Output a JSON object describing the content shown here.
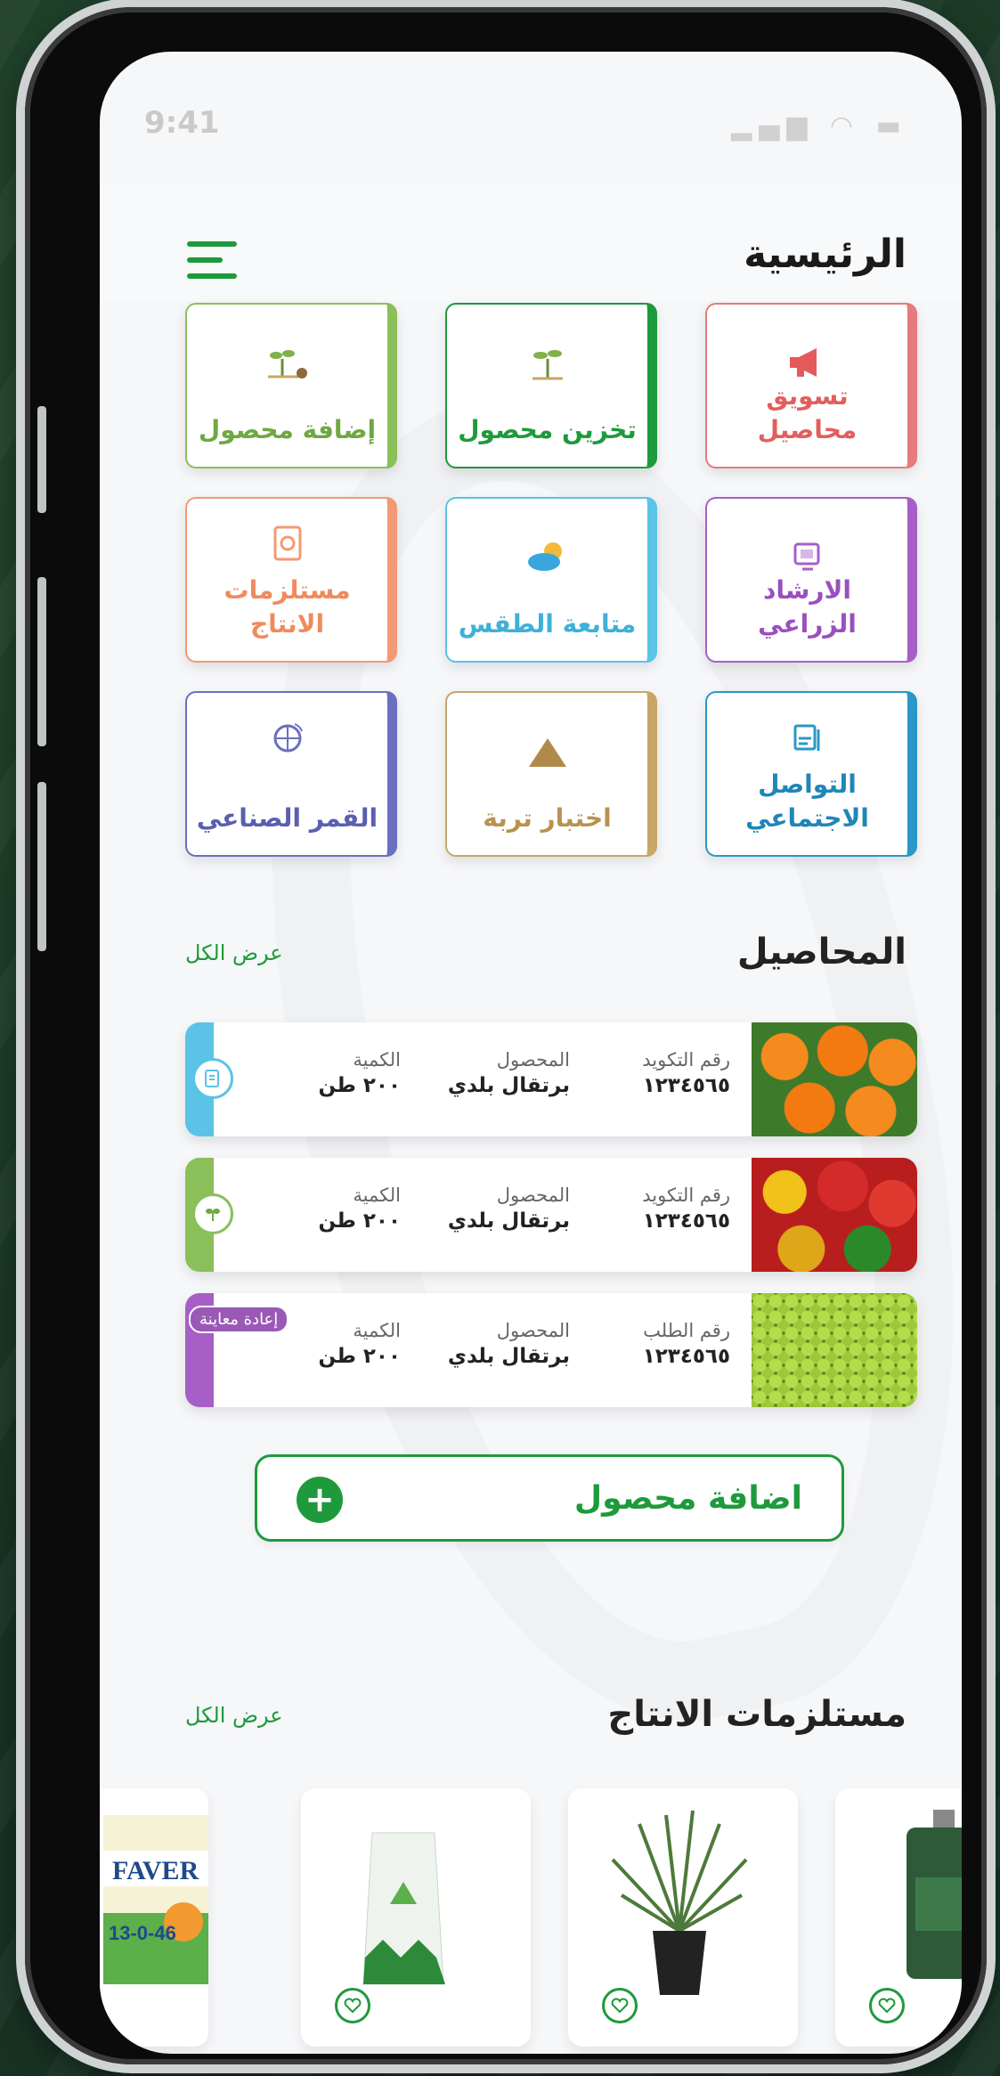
{
  "status_bar": {
    "time": "9:41",
    "icons": [
      "signal-icon",
      "wifi-icon",
      "battery-icon"
    ]
  },
  "header": {
    "title": "الرئيسية",
    "menu_icon": "menu-icon"
  },
  "services": [
    {
      "label": "تسويق محاصيل",
      "icon": "megaphone-icon",
      "color": "#e77a7a"
    },
    {
      "label": "تخزين محصول",
      "icon": "sprout-icon",
      "color": "#1e9a3c"
    },
    {
      "label": "إضافة محصول",
      "icon": "plant-add-icon",
      "color": "#8bbf5a"
    },
    {
      "label": "الارشاد الزراعي",
      "icon": "guide-icon",
      "color": "#a75fc7"
    },
    {
      "label": "متابعة الطقس",
      "icon": "weather-icon",
      "color": "#5bc3e6"
    },
    {
      "label": "مستلزمات الانتاج",
      "icon": "supplies-icon",
      "color": "#f29a73"
    },
    {
      "label": "التواصل الاجتماعي",
      "icon": "social-icon",
      "color": "#2b97c8"
    },
    {
      "label": "اختبار تربة",
      "icon": "soil-icon",
      "color": "#c8a765"
    },
    {
      "label": "القمر الصناعي",
      "icon": "satellite-icon",
      "color": "#6a6fc0"
    }
  ],
  "crops_section": {
    "title": "المحاصيل",
    "view_all": "عرض الكل",
    "items": [
      {
        "code_label": "رقم التكويد",
        "code": "١٢٣٤٥٦٥",
        "product_label": "المحصول",
        "product": "برتقال بلدي",
        "qty_label": "الكمية",
        "qty": "٢٠٠ طن",
        "accent": "#5bc3e6",
        "icon": "crop-doc-icon",
        "photo": "oranges",
        "badge": ""
      },
      {
        "code_label": "رقم التكويد",
        "code": "١٢٣٤٥٦٥",
        "product_label": "المحصول",
        "product": "برتقال بلدي",
        "qty_label": "الكمية",
        "qty": "٢٠٠ طن",
        "accent": "#8bbf5a",
        "icon": "leaf-icon",
        "photo": "peppers",
        "badge": ""
      },
      {
        "code_label": "رقم الطلب",
        "code": "١٢٣٤٥٦٥",
        "product_label": "المحصول",
        "product": "برتقال بلدي",
        "qty_label": "الكمية",
        "qty": "٢٠٠ طن",
        "accent": "#a75fc7",
        "icon": "",
        "photo": "grapes",
        "badge": "إعادة معاينة"
      }
    ]
  },
  "add_crop_button": {
    "label": "اضافة محصول",
    "icon": "plus-icon"
  },
  "supplies_section": {
    "title": "مستلزمات الانتاج",
    "view_all": "عرض الكل",
    "products": [
      {
        "name": "fertilizer-bottle",
        "heart": "heart-icon"
      },
      {
        "name": "plant-pot",
        "heart": "heart-icon"
      },
      {
        "name": "seed-bag",
        "heart": "heart-icon"
      },
      {
        "name": "faver-bag",
        "heart": "heart-icon",
        "text": "FAVER",
        "text2": "13-0-46"
      }
    ]
  }
}
